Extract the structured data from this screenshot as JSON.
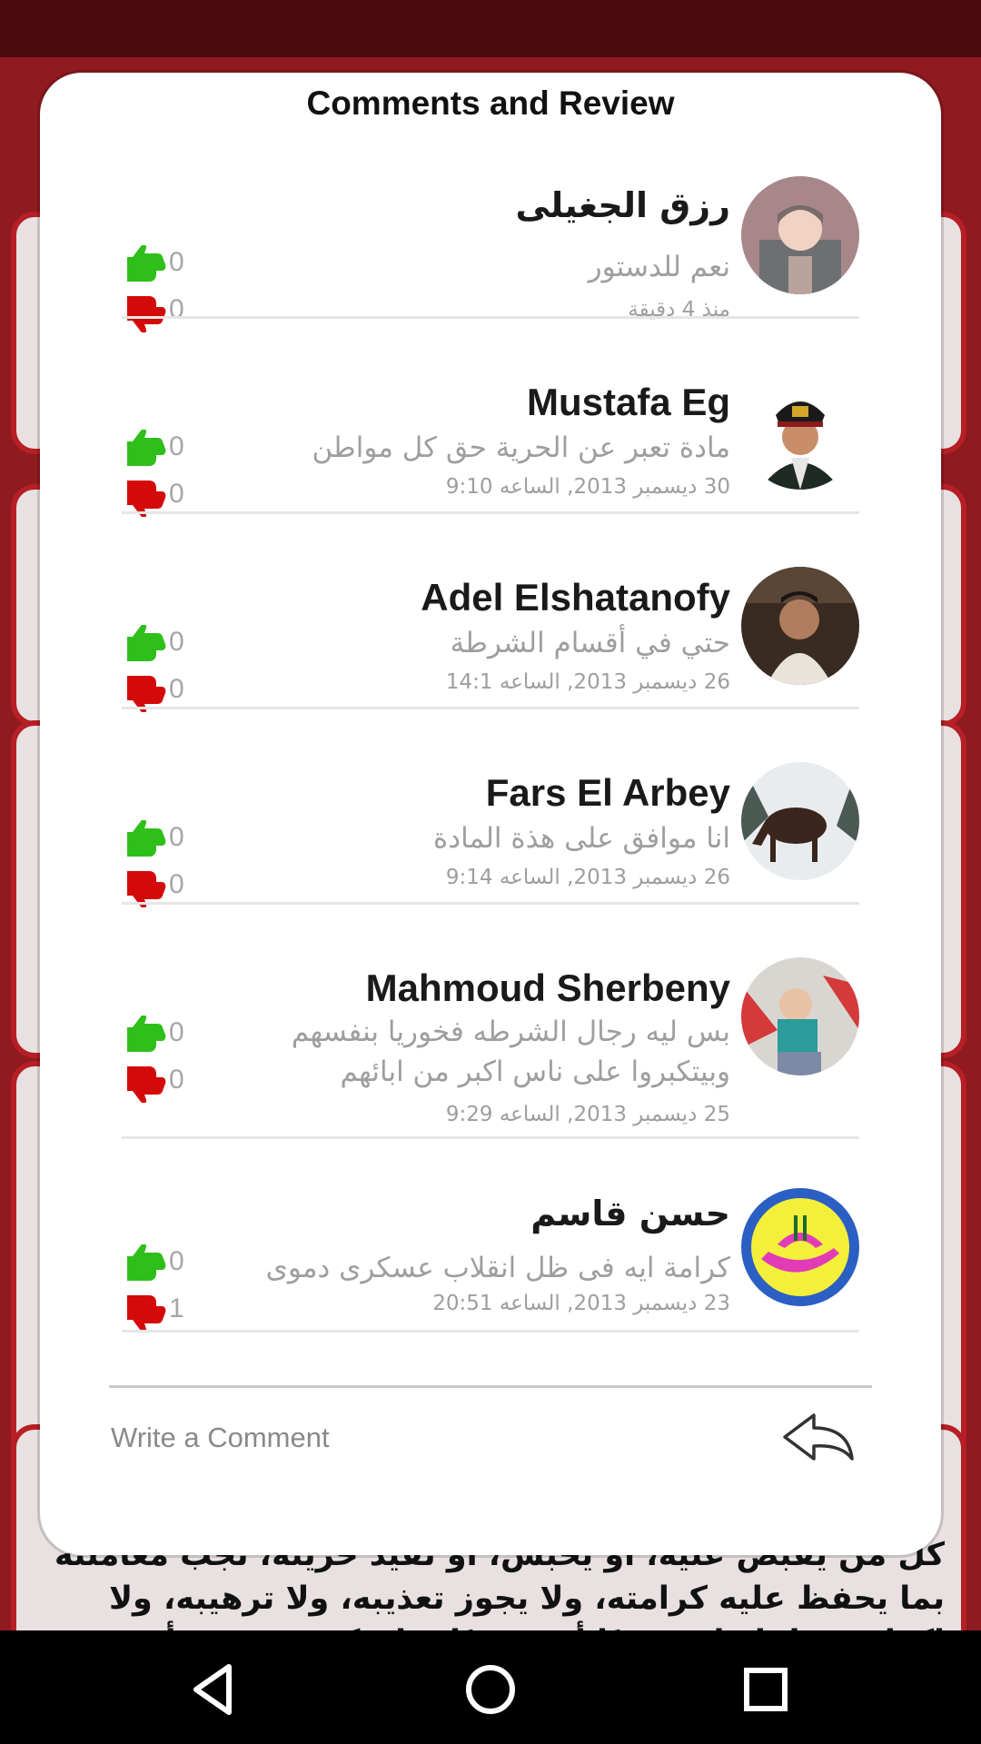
{
  "dialog": {
    "title": "Comments and Review",
    "partial_row": {
      "dislikes": "0"
    },
    "comments": [
      {
        "author": "رزق الجغيلى",
        "author_rtl": true,
        "text": "نعم للدستور",
        "time": "منذ 4 دقيقة",
        "likes": "0",
        "dislikes": "0",
        "avatar": "baby-photo"
      },
      {
        "author": "Mustafa Eg",
        "author_rtl": false,
        "text": "مادة تعبر عن الحرية حق كل مواطن",
        "time": "30 ديسمبر 2013, الساعه 9:10",
        "likes": "0",
        "dislikes": "0",
        "avatar": "officer-photo"
      },
      {
        "author": "Adel Elshatanofy",
        "author_rtl": false,
        "text": "حتي في أقسام الشرطة",
        "time": "26 ديسمبر 2013, الساعه 14:1",
        "likes": "0",
        "dislikes": "0",
        "avatar": "man-photo"
      },
      {
        "author": "Fars El Arbey",
        "author_rtl": false,
        "text": "انا موافق على هذة المادة",
        "time": "26 ديسمبر 2013, الساعه 9:14",
        "likes": "0",
        "dislikes": "0",
        "avatar": "moose-photo"
      },
      {
        "author": "Mahmoud Sherbeny",
        "author_rtl": false,
        "text": "بس ليه رجال الشرطه فخوريا بنفسهم وبيتكبروا على ناس اكبر من ابائهم",
        "time": "25 ديسمبر 2013, الساعه 9:29",
        "likes": "0",
        "dislikes": "0",
        "avatar": "child-photo"
      },
      {
        "author": "حسن قاسم",
        "author_rtl": true,
        "text": "كرامة ايه فى ظل انقلاب عسكرى دموى",
        "time": "23 ديسمبر 2013, الساعه 20:51",
        "likes": "0",
        "dislikes": "1",
        "avatar": "calligraphy-logo"
      }
    ],
    "input": {
      "placeholder": "Write a Comment"
    }
  },
  "background": {
    "lines": [
      "كل من يقبض عليه، أو يحبس، أو تقيد حريته، تجب معاملته",
      "بما يحفظ عليه كرامته، ولا يجوز تعذيبه، ولا ترهيبه، ولا",
      "إكراهه، ولا إيذاؤه بدنيًا أو معنويًا، ولا يكون حجزه، أو حبسه"
    ]
  },
  "icons": {
    "like": "thumbs-up-icon",
    "dislike": "thumbs-down-icon",
    "send": "reply-arrow-icon",
    "nav_back": "back-triangle-icon",
    "nav_home": "home-circle-icon",
    "nav_recents": "recents-square-icon"
  },
  "colors": {
    "like": "#2fbf1a",
    "dislike": "#d40a0a",
    "background": "#8f1a1f",
    "card_border": "#b51f25"
  }
}
